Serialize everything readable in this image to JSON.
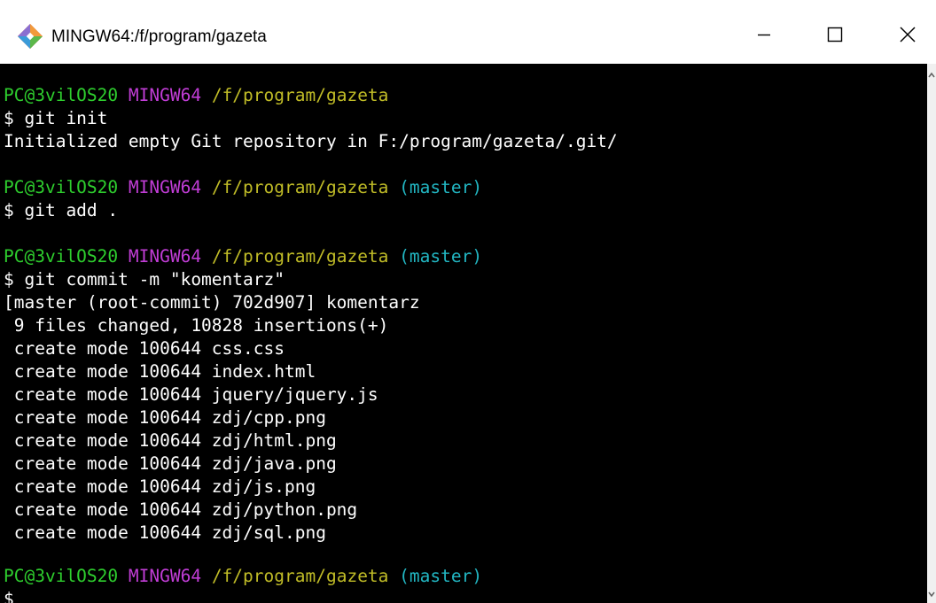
{
  "window": {
    "title": "MINGW64:/f/program/gazeta",
    "icon": "git-bash-icon"
  },
  "controls": {
    "minimize_icon": "minimize-icon",
    "maximize_icon": "maximize-icon",
    "close_icon": "close-icon"
  },
  "colors": {
    "prompt_user": "#2ece2e",
    "prompt_system": "#c13dd6",
    "prompt_path": "#c0bc27",
    "prompt_branch": "#22b6c2",
    "text": "#ffffff",
    "background": "#000000"
  },
  "terminal": {
    "prompt1": {
      "user": "PC@3vilOS20",
      "system": "MINGW64",
      "path": "/f/program/gazeta"
    },
    "cmd1": "$ git init",
    "out1": "Initialized empty Git repository in F:/program/gazeta/.git/",
    "prompt2": {
      "user": "PC@3vilOS20",
      "system": "MINGW64",
      "path": "/f/program/gazeta",
      "branch": "(master)"
    },
    "cmd2": "$ git add .",
    "prompt3": {
      "user": "PC@3vilOS20",
      "system": "MINGW64",
      "path": "/f/program/gazeta",
      "branch": "(master)"
    },
    "cmd3": "$ git commit -m \"komentarz\"",
    "commit_output": [
      "[master (root-commit) 702d907] komentarz",
      " 9 files changed, 10828 insertions(+)",
      " create mode 100644 css.css",
      " create mode 100644 index.html",
      " create mode 100644 jquery/jquery.js",
      " create mode 100644 zdj/cpp.png",
      " create mode 100644 zdj/html.png",
      " create mode 100644 zdj/java.png",
      " create mode 100644 zdj/js.png",
      " create mode 100644 zdj/python.png",
      " create mode 100644 zdj/sql.png"
    ],
    "prompt4": {
      "user": "PC@3vilOS20",
      "system": "MINGW64",
      "path": "/f/program/gazeta",
      "branch": "(master)"
    },
    "cmd4": "$"
  }
}
